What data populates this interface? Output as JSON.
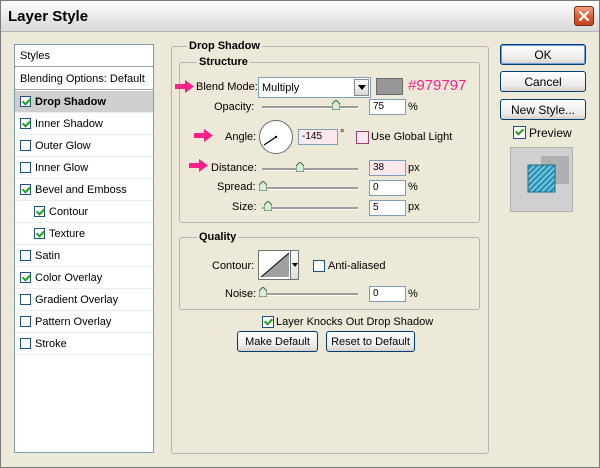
{
  "window": {
    "title": "Layer Style"
  },
  "styles_panel": {
    "header": "Styles",
    "blending_options": "Blending Options: Default",
    "items": [
      {
        "label": "Drop Shadow",
        "checked": true,
        "selected": true,
        "indent": false
      },
      {
        "label": "Inner Shadow",
        "checked": true,
        "selected": false,
        "indent": false
      },
      {
        "label": "Outer Glow",
        "checked": false,
        "selected": false,
        "indent": false
      },
      {
        "label": "Inner Glow",
        "checked": false,
        "selected": false,
        "indent": false
      },
      {
        "label": "Bevel and Emboss",
        "checked": true,
        "selected": false,
        "indent": false
      },
      {
        "label": "Contour",
        "checked": true,
        "selected": false,
        "indent": true
      },
      {
        "label": "Texture",
        "checked": true,
        "selected": false,
        "indent": true
      },
      {
        "label": "Satin",
        "checked": false,
        "selected": false,
        "indent": false
      },
      {
        "label": "Color Overlay",
        "checked": true,
        "selected": false,
        "indent": false
      },
      {
        "label": "Gradient Overlay",
        "checked": false,
        "selected": false,
        "indent": false
      },
      {
        "label": "Pattern Overlay",
        "checked": false,
        "selected": false,
        "indent": false
      },
      {
        "label": "Stroke",
        "checked": false,
        "selected": false,
        "indent": false
      }
    ]
  },
  "drop_shadow": {
    "title": "Drop Shadow",
    "structure": {
      "title": "Structure",
      "blend_mode_label": "Blend Mode:",
      "blend_mode_value": "Multiply",
      "shadow_color": "#979797",
      "color_annotation": "#979797",
      "opacity_label": "Opacity:",
      "opacity_value": "75",
      "opacity_unit": "%",
      "angle_label": "Angle:",
      "angle_value": "-145",
      "angle_unit": "°",
      "use_global_light_label": "Use Global Light",
      "use_global_light_checked": false,
      "distance_label": "Distance:",
      "distance_value": "38",
      "distance_unit": "px",
      "spread_label": "Spread:",
      "spread_value": "0",
      "spread_unit": "%",
      "size_label": "Size:",
      "size_value": "5",
      "size_unit": "px"
    },
    "quality": {
      "title": "Quality",
      "contour_label": "Contour:",
      "anti_aliased_label": "Anti-aliased",
      "anti_aliased_checked": false,
      "noise_label": "Noise:",
      "noise_value": "0",
      "noise_unit": "%"
    },
    "knocks_out_label": "Layer Knocks Out Drop Shadow",
    "knocks_out_checked": true,
    "make_default_label": "Make Default",
    "reset_default_label": "Reset to Default"
  },
  "buttons": {
    "ok": "OK",
    "cancel": "Cancel",
    "new_style": "New Style...",
    "preview_label": "Preview",
    "preview_checked": true
  },
  "colors": {
    "annotation": "#ff1f8a",
    "selection": "#cfcfcf"
  }
}
